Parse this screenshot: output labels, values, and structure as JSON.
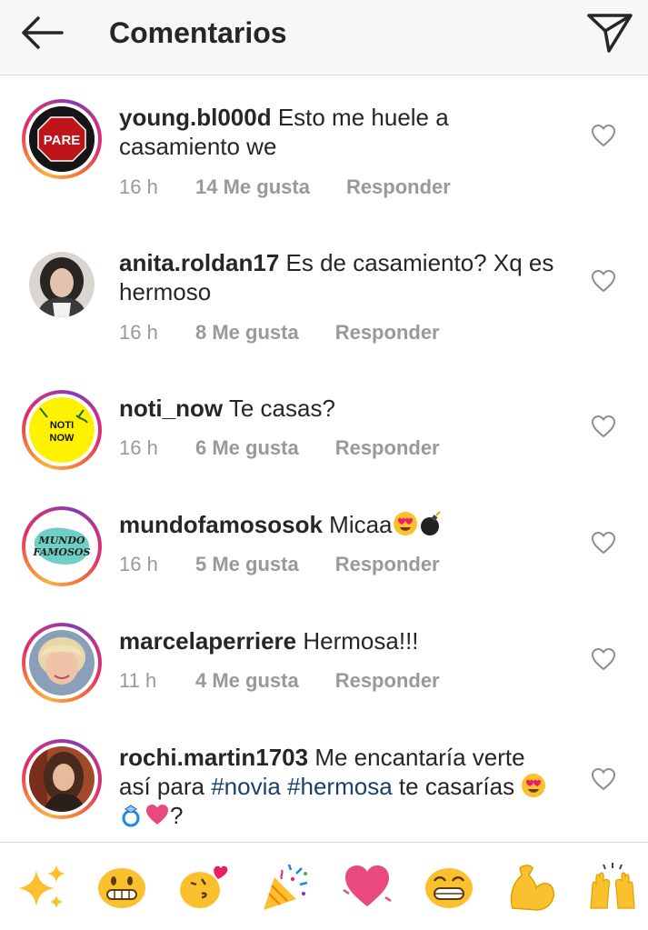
{
  "header": {
    "title": "Comentarios",
    "back_icon": "arrow-left-icon",
    "send_icon": "paper-plane-icon"
  },
  "comments": [
    {
      "username": "young.bl000d",
      "text": "Esto me huele a casamiento we",
      "time": "16 h",
      "likes": "14 Me gusta",
      "reply": "Responder",
      "avatar_text": "PARE"
    },
    {
      "username": "anita.roldan17",
      "text": "Es de casamiento? Xq es hermoso",
      "time": "16 h",
      "likes": "8 Me gusta",
      "reply": "Responder"
    },
    {
      "username": "noti_now",
      "text": "Te casas?",
      "time": "16 h",
      "likes": "6 Me gusta",
      "reply": "Responder",
      "avatar_text_1": "NOTI",
      "avatar_text_2": "NOW"
    },
    {
      "username": "mundofamososok",
      "text": "Micaa",
      "time": "16 h",
      "likes": "5 Me gusta",
      "reply": "Responder",
      "avatar_text_1": "MUNDO",
      "avatar_text_2": "FAMOSOS",
      "text_emojis": [
        "heart-eyes-emoji",
        "bomb-emoji"
      ]
    },
    {
      "username": "marcelaperriere",
      "text": "Hermosa!!!",
      "time": "11 h",
      "likes": "4 Me gusta",
      "reply": "Responder"
    },
    {
      "username": "rochi.martin1703",
      "text_before": "Me encantaría verte así para",
      "hashtag_1": "#novia",
      "hashtag_2": "#hermosa",
      "text_after": "te casarías",
      "text_end": "?",
      "text_emojis": [
        "heart-eyes-emoji",
        "ring-emoji",
        "heart-emoji"
      ]
    }
  ],
  "emoji_bar": [
    "sparkles-emoji",
    "grinning-emoji",
    "kissing-heart-emoji",
    "party-popper-emoji",
    "heart-emoji",
    "beaming-emoji",
    "flexed-biceps-emoji",
    "raising-hands-emoji"
  ],
  "colors": {
    "text": "#262626",
    "meta": "#999999",
    "hashtag": "#1c3f6e",
    "header_bg": "#f7f7f7"
  }
}
